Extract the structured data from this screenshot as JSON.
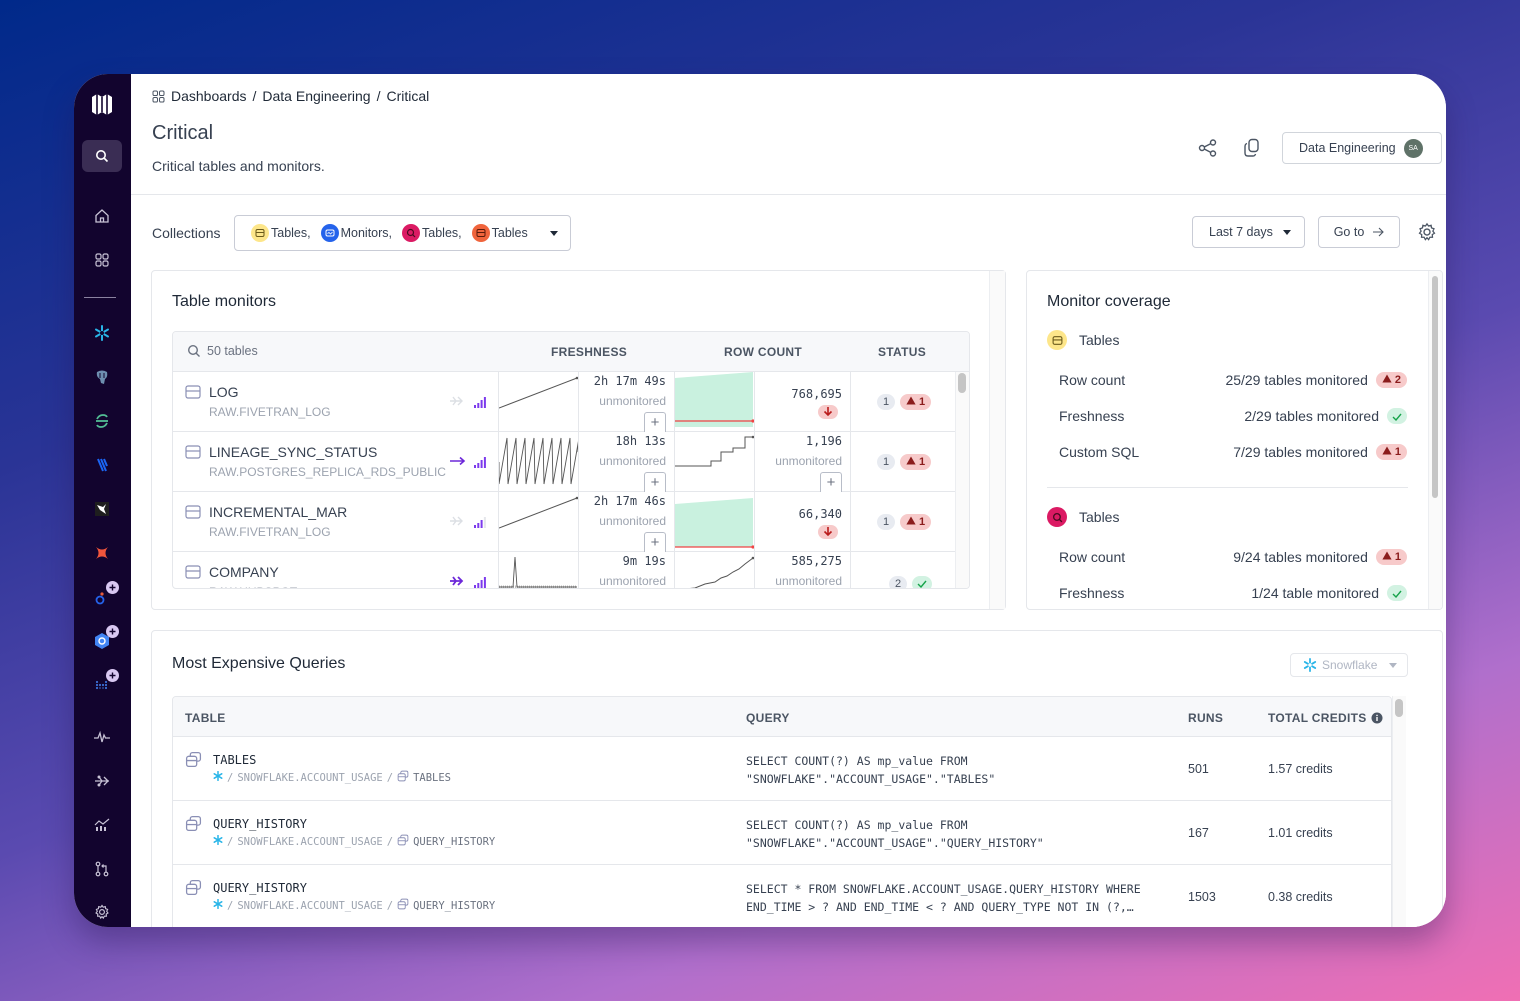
{
  "breadcrumb": {
    "items": [
      "Dashboards",
      "Data Engineering",
      "Critical"
    ],
    "text": "Dashboards / Data Engineering / Critical"
  },
  "page": {
    "title": "Critical",
    "subtitle": "Critical tables and monitors."
  },
  "header": {
    "team_label": "Data Engineering",
    "avatar_initials": "SA"
  },
  "toolbar": {
    "collections_label": "Collections",
    "collections": [
      {
        "label": "Tables,",
        "icon": "table-icon",
        "color": "#fde68a"
      },
      {
        "label": "Monitors,",
        "icon": "monitor-icon",
        "color": "#2563eb"
      },
      {
        "label": "Tables,",
        "icon": "search-table-icon",
        "color": "#db1a63"
      },
      {
        "label": "Tables",
        "icon": "table-icon",
        "color": "#f0643c"
      }
    ],
    "range_label": "Last 7 days",
    "goto_label": "Go to"
  },
  "table_monitors": {
    "title": "Table monitors",
    "search_label": "50 tables",
    "columns": [
      "FRESHNESS",
      "ROW COUNT",
      "STATUS"
    ],
    "rows": [
      {
        "name": "LOG",
        "schema": "RAW.FIVETRAN_LOG",
        "freshness": "2h 17m 49s",
        "freshness_sub": "unmonitored",
        "row_count": "768,695",
        "row_count_sub": "",
        "row_count_alert": true,
        "status_count": "1",
        "status_warn": "1",
        "status_ok": false
      },
      {
        "name": "LINEAGE_SYNC_STATUS",
        "schema": "RAW.POSTGRES_REPLICA_RDS_PUBLIC",
        "freshness": "18h 13s",
        "freshness_sub": "unmonitored",
        "row_count": "1,196",
        "row_count_sub": "unmonitored",
        "row_count_alert": false,
        "status_count": "1",
        "status_warn": "1",
        "status_ok": false
      },
      {
        "name": "INCREMENTAL_MAR",
        "schema": "RAW.FIVETRAN_LOG",
        "freshness": "2h 17m 46s",
        "freshness_sub": "unmonitored",
        "row_count": "66,340",
        "row_count_sub": "",
        "row_count_alert": true,
        "status_count": "1",
        "status_warn": "1",
        "status_ok": false
      },
      {
        "name": "COMPANY",
        "schema": "RAW.HUBSPOT",
        "freshness": "9m 19s",
        "freshness_sub": "unmonitored",
        "row_count": "585,275",
        "row_count_sub": "unmonitored",
        "row_count_alert": false,
        "status_count": "2",
        "status_warn": "",
        "status_ok": true
      }
    ]
  },
  "monitor_coverage": {
    "title": "Monitor coverage",
    "groups": [
      {
        "label": "Tables",
        "icon": "table-icon",
        "lines": [
          {
            "label": "Row count",
            "text": "25/29 tables monitored",
            "badge": "2",
            "ok": false
          },
          {
            "label": "Freshness",
            "text": "2/29 tables monitored",
            "badge": "",
            "ok": true
          },
          {
            "label": "Custom SQL",
            "text": "7/29 tables monitored",
            "badge": "1",
            "ok": false
          }
        ]
      },
      {
        "label": "Tables",
        "icon": "search-table-icon",
        "lines": [
          {
            "label": "Row count",
            "text": "9/24 tables monitored",
            "badge": "1",
            "ok": false
          },
          {
            "label": "Freshness",
            "text": "1/24 table monitored",
            "badge": "",
            "ok": true
          }
        ]
      }
    ]
  },
  "expensive_queries": {
    "title": "Most Expensive Queries",
    "warehouse": "Snowflake",
    "columns": [
      "TABLE",
      "QUERY",
      "RUNS",
      "TOTAL CREDITS"
    ],
    "rows": [
      {
        "table": "TABLES",
        "path": "SNOWFLAKE.ACCOUNT_USAGE",
        "leaf": "TABLES",
        "query": "SELECT COUNT(?) AS mp_value FROM\n\"SNOWFLAKE\".\"ACCOUNT_USAGE\".\"TABLES\"",
        "runs": "501",
        "credits": "1.57 credits"
      },
      {
        "table": "QUERY_HISTORY",
        "path": "SNOWFLAKE.ACCOUNT_USAGE",
        "leaf": "QUERY_HISTORY",
        "query": "SELECT COUNT(?) AS mp_value FROM\n\"SNOWFLAKE\".\"ACCOUNT_USAGE\".\"QUERY_HISTORY\"",
        "runs": "167",
        "credits": "1.01 credits"
      },
      {
        "table": "QUERY_HISTORY",
        "path": "SNOWFLAKE.ACCOUNT_USAGE",
        "leaf": "QUERY_HISTORY",
        "query": "SELECT * FROM SNOWFLAKE.ACCOUNT_USAGE.QUERY_HISTORY WHERE\nEND_TIME > ? AND END_TIME < ? AND QUERY_TYPE NOT IN (?,…",
        "runs": "1503",
        "credits": "0.38 credits"
      }
    ]
  },
  "colors": {
    "accent": "#7c3aed",
    "danger_bg": "#f7caca",
    "danger": "#8b1c1c",
    "ok_bg": "#d2f2e2",
    "ok": "#16a34a",
    "sidebar": "#12042e"
  }
}
